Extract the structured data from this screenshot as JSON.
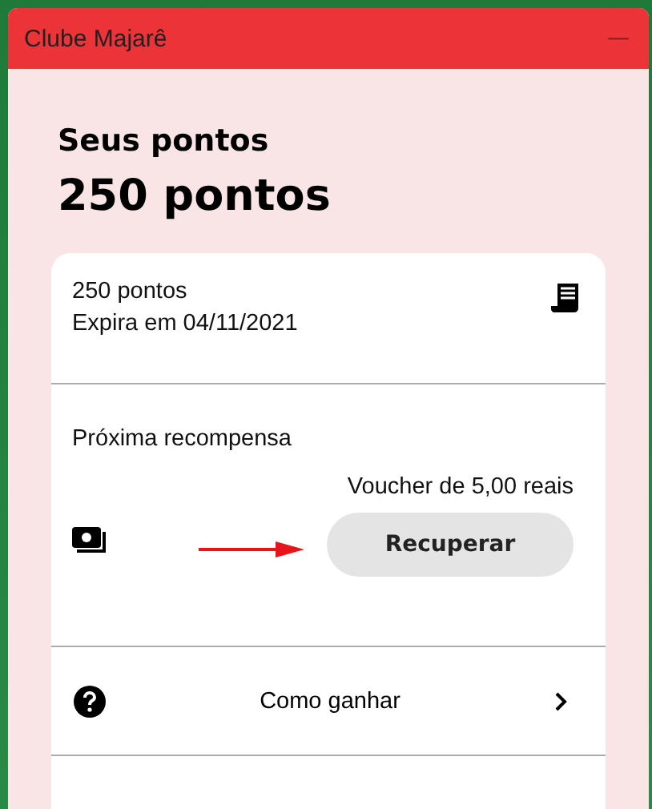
{
  "window": {
    "title": "Clube Majarê",
    "minimize_label": "—"
  },
  "heading": "Seus pontos",
  "points_total": "250 pontos",
  "card": {
    "points": "250 pontos",
    "expiry": "Expira em 04/11/2021",
    "next_reward": {
      "label": "Próxima recompensa",
      "reward": "Voucher de 5,00 reais",
      "button": "Recuperar"
    },
    "links": [
      {
        "label": "Como ganhar"
      }
    ]
  }
}
